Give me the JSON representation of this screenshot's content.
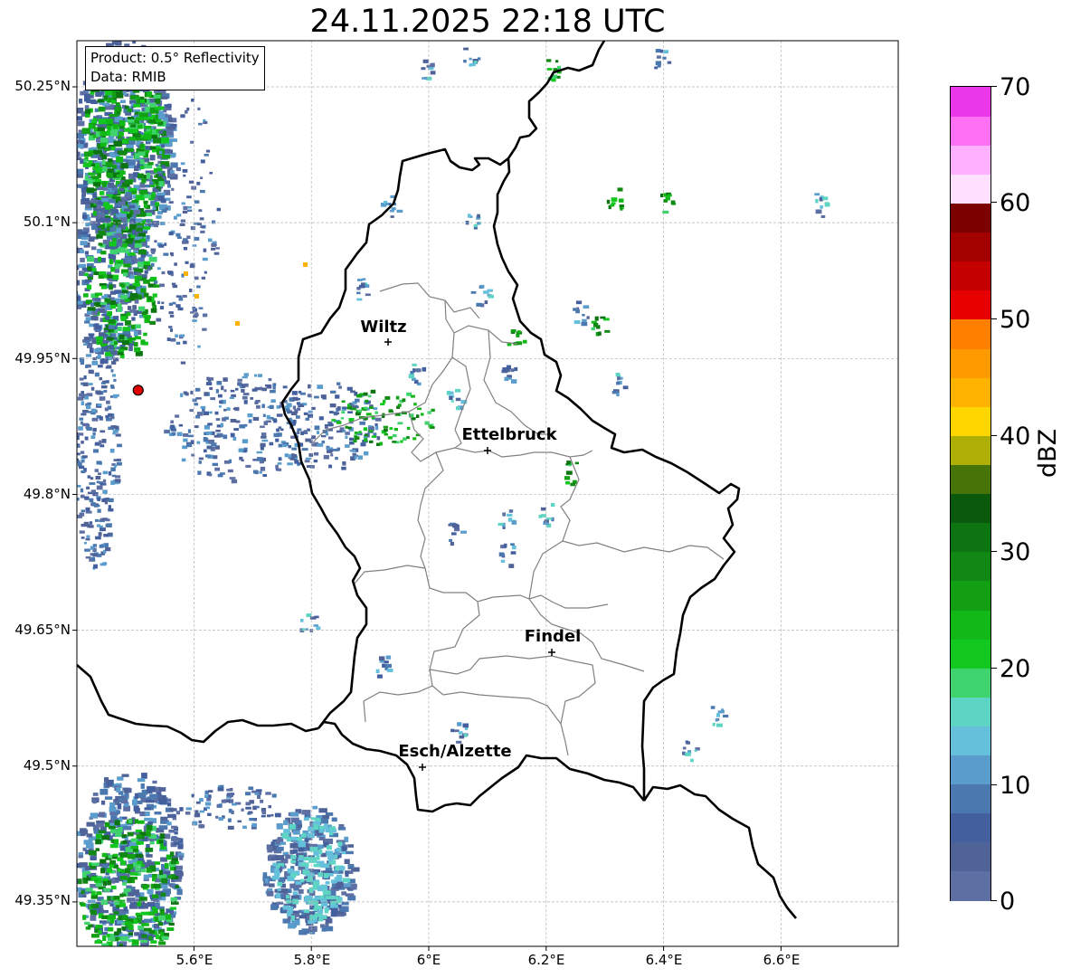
{
  "title": "24.11.2025 22:18 UTC",
  "info": {
    "product": "Product: 0.5° Reflectivity",
    "data_source": "Data: RMIB"
  },
  "axes": {
    "lat_ticks": [
      "50.25°N",
      "50.1°N",
      "49.95°N",
      "49.8°N",
      "49.65°N",
      "49.5°N",
      "49.35°N"
    ],
    "lon_ticks": [
      "5.6°E",
      "5.8°E",
      "6°E",
      "6.2°E",
      "6.4°E",
      "6.6°E"
    ]
  },
  "cities": [
    {
      "name": "Wiltz",
      "lon": 5.93,
      "lat": 49.97
    },
    {
      "name": "Ettelbruck",
      "lon": 6.1,
      "lat": 49.85
    },
    {
      "name": "Findel",
      "lon": 6.21,
      "lat": 49.63
    },
    {
      "name": "Esch/Alzette",
      "lon": 5.99,
      "lat": 49.5
    }
  ],
  "radar_site": {
    "lon": 5.505,
    "lat": 49.915,
    "color": "#e00000"
  },
  "colorbar": {
    "unit": "dBZ",
    "min": 0,
    "max": 70,
    "tick_labels": [
      "0",
      "10",
      "20",
      "30",
      "40",
      "50",
      "60",
      "70"
    ],
    "colors": [
      "#5d6fa3",
      "#4f6399",
      "#435f9e",
      "#4a78af",
      "#5a9ccc",
      "#65c0dc",
      "#5ed4c4",
      "#3fd36e",
      "#12c81e",
      "#12b718",
      "#129f14",
      "#118813",
      "#0c7410",
      "#0a590c",
      "#477409",
      "#aeaf06",
      "#ffd600",
      "#ffb300",
      "#ff9a00",
      "#ff7f00",
      "#e60000",
      "#c40000",
      "#a30000",
      "#7d0000",
      "#ffe0ff",
      "#ffb0ff",
      "#ff70f5",
      "#ea37ea"
    ]
  }
}
